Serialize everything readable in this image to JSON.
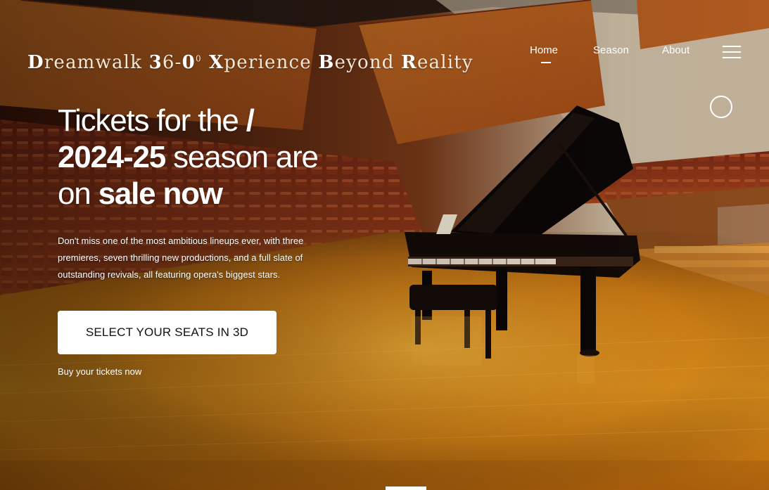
{
  "header": {
    "brand": {
      "parts": [
        {
          "cap": "D",
          "rest": "reamwalk "
        },
        {
          "cap": "3",
          "rest": "6-"
        },
        {
          "cap": "0",
          "rest": ""
        },
        {
          "sup": "0"
        },
        {
          "cap": " X",
          "rest": "perience "
        },
        {
          "cap": "B",
          "rest": "eyond "
        },
        {
          "cap": "R",
          "rest": "eality"
        }
      ]
    },
    "nav": {
      "home": "Home",
      "season": "Season",
      "about": "About",
      "active": "Home"
    },
    "menu_icon": "hamburger-menu-icon"
  },
  "hero": {
    "title_line1_light": "Tickets for the",
    "title_line1_slash": "/",
    "title_line2_bold": "2024-25",
    "title_line2_light": " season are",
    "title_line3_light": "on ",
    "title_line3_bold": "sale now",
    "description": "Don't miss one of the most ambitious lineups ever, with three premieres, seven thrilling new productions, and a full slate of outstanding revivals, all featuring opera's biggest stars.",
    "cta_label": "SELECT YOUR SEATS IN 3D",
    "secondary_link": "Buy your tickets now"
  },
  "colors": {
    "stage_floor": "#c8780f",
    "wall_panels": "#b5531c",
    "seats": "#8a2f16",
    "piano": "#0b0706",
    "text": "#ffffff",
    "button_bg": "#ffffff",
    "button_text": "#111111"
  }
}
